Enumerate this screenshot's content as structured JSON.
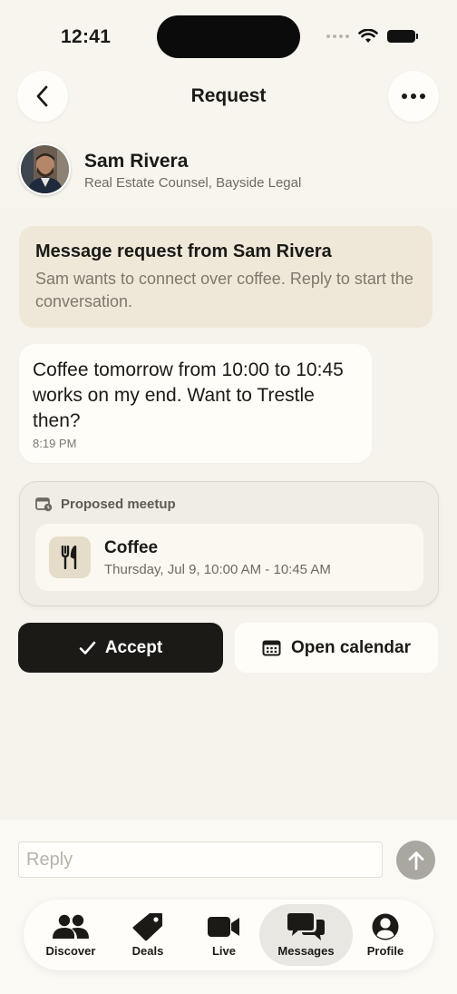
{
  "status_bar": {
    "time": "12:41"
  },
  "nav": {
    "title": "Request"
  },
  "contact": {
    "name": "Sam Rivera",
    "title": "Real Estate Counsel, Bayside Legal"
  },
  "request_banner": {
    "title": "Message request from Sam Rivera",
    "body": "Sam wants to connect over coffee. Reply to start the conversation."
  },
  "message": {
    "text": "Coffee tomorrow from 10:00 to 10:45 works on my end. Want to Trestle then?",
    "time": "8:19 PM"
  },
  "meetup": {
    "header": "Proposed meetup",
    "type": "Coffee",
    "datetime": "Thursday, Jul 9, 10:00 AM - 10:45 AM"
  },
  "actions": {
    "accept_label": "Accept",
    "calendar_label": "Open calendar"
  },
  "composer": {
    "placeholder": "Reply"
  },
  "tabs": [
    {
      "label": "Discover",
      "icon": "people-icon"
    },
    {
      "label": "Deals",
      "icon": "tag-icon"
    },
    {
      "label": "Live",
      "icon": "video-icon"
    },
    {
      "label": "Messages",
      "icon": "chat-bubbles-icon",
      "active": true
    },
    {
      "label": "Profile",
      "icon": "person-circle-icon"
    }
  ],
  "colors": {
    "background": "#f8f5ee",
    "accent_dark": "#1b1a17",
    "banner": "#efe7d8"
  }
}
